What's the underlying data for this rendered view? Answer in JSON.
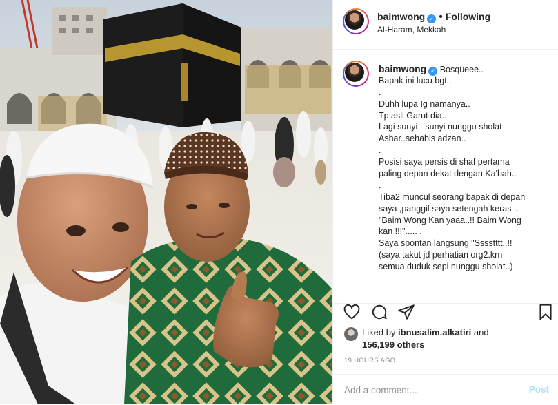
{
  "post": {
    "username": "baimwong",
    "verified_mark": "✓",
    "separator": "•",
    "follow_status": "Following",
    "location": "Al-Haram, Mekkah"
  },
  "caption": {
    "username": "baimwong",
    "lines": [
      "Bosqueee..",
      "Bapak ini lucu bgt..",
      ".",
      "Duhh lupa Ig namanya..",
      "Tp asli Garut dia..",
      "Lagi sunyi - sunyi nunggu sholat",
      "Ashar..sehabis adzan..",
      ".",
      "Posisi saya persis di shaf pertama",
      "paling depan dekat dengan Ka'bah..",
      ".",
      "Tiba2 muncul seorang bapak di depan",
      "saya ,panggil saya setengah keras ..",
      "\"Baim Wong Kan yaaa..!! Baim Wong",
      "kan !!!\"..... .",
      "Saya spontan langsung \"Sssstttt..!!",
      "(saya takut jd perhatian org2.krn",
      "semua duduk sepi nunggu sholat..)"
    ]
  },
  "likes": {
    "prefix": "Liked by",
    "user": "ibnusalim.alkatiri",
    "and": "and",
    "count": "156,199 others"
  },
  "timestamp": "19 HOURS AGO",
  "comment": {
    "placeholder": "Add a comment...",
    "post_label": "Post"
  },
  "icons": [
    "heart-icon",
    "comment-icon",
    "share-icon",
    "bookmark-icon",
    "verified-badge-icon"
  ],
  "colors": {
    "verified": "#3897f0",
    "post_disabled": "#b2dffc",
    "muted": "#8e8e8e",
    "border": "#efefef"
  }
}
